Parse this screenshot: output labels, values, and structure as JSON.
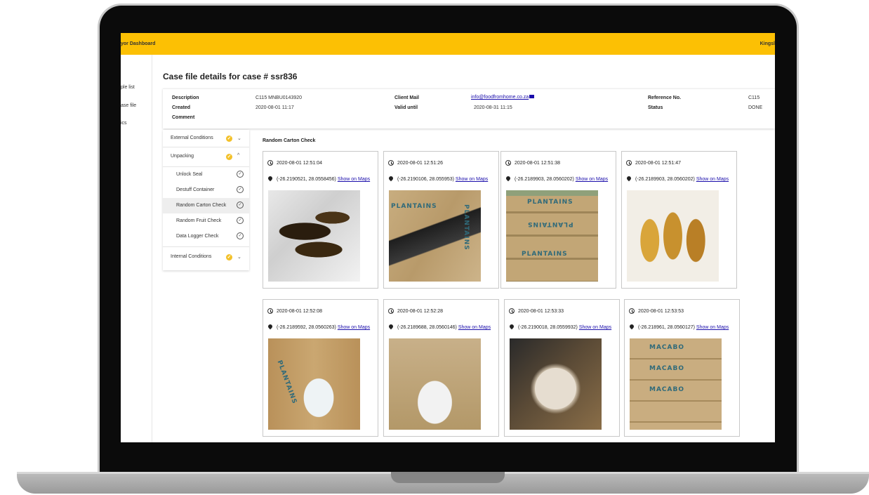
{
  "topbar": {
    "title": "yor Dashboard",
    "user": "Kingsl"
  },
  "nav": [
    "ple list",
    "ase file",
    "ics"
  ],
  "page_title": "Case file details for case # ssr836",
  "details": {
    "description_label": "Description",
    "description_value": "C115 MNBU0143920",
    "created_label": "Created",
    "created_value": "2020-08-01 11:17",
    "comment_label": "Comment",
    "client_mail_label": "Client Mail",
    "client_mail_value": "info@foodfromhome.co.za",
    "valid_until_label": "Valid until",
    "valid_until_value": "2020-08-31 11:15",
    "reference_label": "Reference No.",
    "reference_value": "C115",
    "status_label": "Status",
    "status_value": "DONE"
  },
  "steps": {
    "groups": [
      {
        "label": "External Conditions"
      },
      {
        "label": "Unpacking"
      },
      {
        "label": "Internal Conditions"
      }
    ],
    "substeps": [
      {
        "label": "Unlock Seal"
      },
      {
        "label": "Destuff Container"
      },
      {
        "label": "Random Carton Check",
        "active": true
      },
      {
        "label": "Random Fruit Check"
      },
      {
        "label": "Data Logger Check"
      }
    ]
  },
  "gallery": {
    "title": "Random Carton Check",
    "maps_label": "Show on Maps",
    "photo_labels": {
      "plantains": "PLANTAINS",
      "macabo": "MACABO"
    },
    "cards": [
      {
        "time": "2020-08-01 12:51:04",
        "coords": "(-26.2190521, 28.0558456)"
      },
      {
        "time": "2020-08-01 12:51:26",
        "coords": "(-26.2190106, 28.055953)"
      },
      {
        "time": "2020-08-01 12:51:38",
        "coords": "(-26.2189903, 28.0560202)"
      },
      {
        "time": "2020-08-01 12:51:47",
        "coords": "(-26.2189903, 28.0560202)"
      },
      {
        "time": "2020-08-01 12:52:08",
        "coords": "(-26.2189592, 28.0560263)"
      },
      {
        "time": "2020-08-01 12:52:28",
        "coords": "(-26.2189688, 28.0560146)"
      },
      {
        "time": "2020-08-01 12:53:33",
        "coords": "(-26.2190018, 28.0559932)"
      },
      {
        "time": "2020-08-01 12:53:53",
        "coords": "(-26.218961, 28.0560127)"
      }
    ]
  },
  "colors": {
    "accent": "#fcc004",
    "link": "#1a0dab",
    "check": "#f3c12a"
  }
}
